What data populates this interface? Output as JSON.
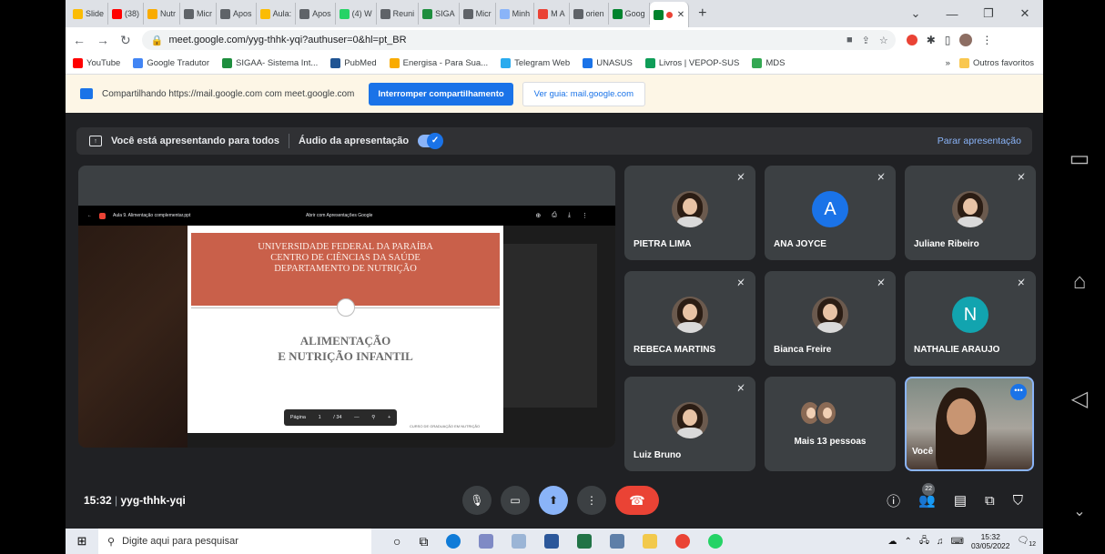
{
  "browser": {
    "tabs": [
      {
        "label": "Slide",
        "color": "#fbbc04"
      },
      {
        "label": "(38)",
        "color": "#ff0000"
      },
      {
        "label": "Nutr",
        "color": "#f9ab00"
      },
      {
        "label": "Micr",
        "color": "#5f6368"
      },
      {
        "label": "Apos",
        "color": "#5f6368"
      },
      {
        "label": "Aula:",
        "color": "#fbbc04"
      },
      {
        "label": "Apos",
        "color": "#5f6368"
      },
      {
        "label": "(4) W",
        "color": "#25d366"
      },
      {
        "label": "Reuni",
        "color": "#5f6368"
      },
      {
        "label": "SIGA",
        "color": "#1e8e3e"
      },
      {
        "label": "Micr",
        "color": "#5f6368"
      },
      {
        "label": "Minh",
        "color": "#8ab4f8"
      },
      {
        "label": "M A",
        "color": "#ea4335"
      },
      {
        "label": "orien",
        "color": "#5f6368"
      },
      {
        "label": "Goog",
        "color": "#00832d"
      }
    ],
    "url": "meet.google.com/yyg-thhk-yqi?authuser=0&hl=pt_BR",
    "bookmarks": [
      {
        "label": "YouTube",
        "color": "#ff0000"
      },
      {
        "label": "Google Tradutor",
        "color": "#4285f4"
      },
      {
        "label": "SIGAA- Sistema Int...",
        "color": "#1e8e3e"
      },
      {
        "label": "PubMed",
        "color": "#205493"
      },
      {
        "label": "Energisa - Para Sua...",
        "color": "#f9ab00"
      },
      {
        "label": "Telegram Web",
        "color": "#2aabee"
      },
      {
        "label": "UNASUS",
        "color": "#1a73e8"
      },
      {
        "label": "Livros | VEPOP-SUS",
        "color": "#0f9d58"
      },
      {
        "label": "MDS",
        "color": "#34a853"
      }
    ],
    "other_bookmarks": "Outros favoritos"
  },
  "infobar": {
    "text": "Compartilhando https://mail.google.com com meet.google.com",
    "stop_label": "Interromper compartilhamento",
    "view_label": "Ver guia: mail.google.com"
  },
  "presbar": {
    "presenting": "Você está apresentando para todos",
    "audio": "Áudio da apresentação",
    "stop": "Parar apresentação"
  },
  "slide": {
    "doc_title": "Aula 9. Alimentação complementar.ppt",
    "open_with": "Abrir com Apresentações Google",
    "header_lines": [
      "UNIVERSIDADE FEDERAL DA PARAÍBA",
      "CENTRO DE CIÊNCIAS DA SAÚDE",
      "DEPARTAMENTO DE NUTRIÇÃO"
    ],
    "title_lines": [
      "ALIMENTAÇÃO",
      "E NUTRIÇÃO INFANTIL"
    ],
    "page_label": "Página",
    "page_current": "1",
    "page_total": "/ 34",
    "footer": "CURSO DE GRADUAÇÃO EM NUTRIÇÃO"
  },
  "participants": [
    {
      "name": "PIETRA LIMA",
      "kind": "photo"
    },
    {
      "name": "ANA JOYCE",
      "kind": "letter",
      "letter": "A",
      "color": "#1a73e8"
    },
    {
      "name": "Juliane Ribeiro",
      "kind": "photo"
    },
    {
      "name": "REBECA MARTINS",
      "kind": "photo"
    },
    {
      "name": "Bianca Freire",
      "kind": "photo"
    },
    {
      "name": "NATHALIE ARAUJO",
      "kind": "letter",
      "letter": "N",
      "color": "#12a4af"
    },
    {
      "name": "Luiz Bruno",
      "kind": "photo"
    }
  ],
  "more_people": "Mais 13 pessoas",
  "self_name": "Você",
  "meeting": {
    "time": "15:32",
    "code": "yyg-thhk-yqi",
    "participant_count": "22"
  },
  "taskbar": {
    "search_placeholder": "Digite aqui para pesquisar",
    "time": "15:32",
    "date": "03/05/2022",
    "notifications": "12"
  }
}
